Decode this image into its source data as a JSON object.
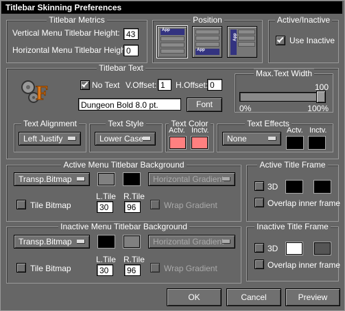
{
  "window": {
    "title": "Titlebar Skinning Preferences"
  },
  "metrics": {
    "title": "Titlebar Metrics",
    "vertical_label": "Vertical Menu Titlebar Height:",
    "vertical_value": "43",
    "horizontal_label": "Horizontal Menu Titlebar Height:",
    "horizontal_value": "0"
  },
  "position": {
    "title": "Position",
    "icon_label": "App"
  },
  "active_inactive": {
    "title": "Active/Inactive",
    "use_inactive_label": "Use Inactive",
    "use_inactive_checked": true
  },
  "titlebar_text": {
    "title": "Titlebar Text",
    "no_text_label": "No Text",
    "no_text_checked": true,
    "v_offset_label": "V.Offset:",
    "v_offset_value": "1",
    "h_offset_label": "H.Offset:",
    "h_offset_value": "0",
    "font_value": "Dungeon Bold 8.0 pt.",
    "font_button": "Font"
  },
  "max_text_width": {
    "title": "Max.Text Width",
    "value": "100",
    "min_label": "0%",
    "max_label": "100%",
    "slider_fraction": 1.0
  },
  "text_alignment": {
    "title": "Text Alignment",
    "value": "Left Justify"
  },
  "text_style": {
    "title": "Text Style",
    "value": "Lower Case"
  },
  "text_color": {
    "title": "Text Color",
    "active_label": "Actv.",
    "inactive_label": "Inctv.",
    "active_color": "#ff8080",
    "inactive_color": "#ff8080"
  },
  "text_effects": {
    "title": "Text Effects",
    "value": "None",
    "active_label": "Actv.",
    "inactive_label": "Inctv.",
    "active_color": "#000000",
    "inactive_color": "#000000"
  },
  "active_menu_bg": {
    "title": "Active Menu Titlebar Background",
    "type_value": "Transp.Bitmap",
    "color1": "#808080",
    "color2": "#000000",
    "gradient_value": "Horizontal Gradient",
    "tile_bitmap_label": "Tile Bitmap",
    "ltile_label": "L.Tile",
    "ltile_value": "30",
    "rtile_label": "R.Tile",
    "rtile_value": "96",
    "wrap_gradient_label": "Wrap Gradient"
  },
  "active_title_frame": {
    "title": "Active Title Frame",
    "three_d_label": "3D",
    "color1": "#000000",
    "color2": "#000000",
    "overlap_label": "Overlap inner frame"
  },
  "inactive_menu_bg": {
    "title": "Inactive Menu Titlebar Background",
    "type_value": "Transp.Bitmap",
    "color1": "#000000",
    "color2": "#808080",
    "gradient_value": "Horizontal Gradient",
    "tile_bitmap_label": "Tile Bitmap",
    "ltile_label": "L.Tile",
    "ltile_value": "30",
    "rtile_label": "R.Tile",
    "rtile_value": "96",
    "wrap_gradient_label": "Wrap Gradient"
  },
  "inactive_title_frame": {
    "title": "Inactive Title Frame",
    "three_d_label": "3D",
    "color1": "#ffffff",
    "color2": "#555555",
    "overlap_label": "Overlap inner frame"
  },
  "buttons": {
    "ok": "OK",
    "cancel": "Cancel",
    "preview": "Preview"
  }
}
